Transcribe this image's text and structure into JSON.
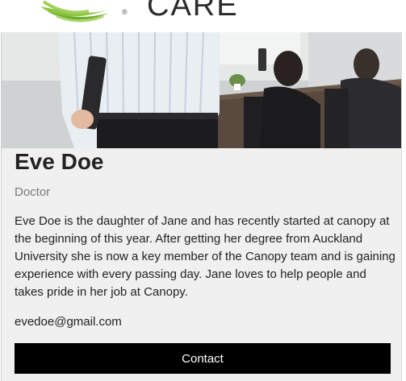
{
  "header": {
    "logo_text": "CARE",
    "registered_mark": "®"
  },
  "profile": {
    "name": "Eve Doe",
    "role": "Doctor",
    "bio": "Eve Doe is the daughter of Jane and has recently started at canopy at the beginning of this year. After getting her degree from Auckland University she is now a key member of the Canopy team and is gaining experience with every passing day. Jane loves to help people and takes pride in her job at Canopy.",
    "email": "evedoe@gmail.com",
    "contact_label": "Contact"
  },
  "colors": {
    "card_bg": "#f0f0f0",
    "button_bg": "#000000",
    "button_text": "#ffffff",
    "logo_green": "#8cc63f"
  },
  "icons": {
    "logo": "leaf-logo-icon",
    "hero": "office-meeting-photo"
  }
}
